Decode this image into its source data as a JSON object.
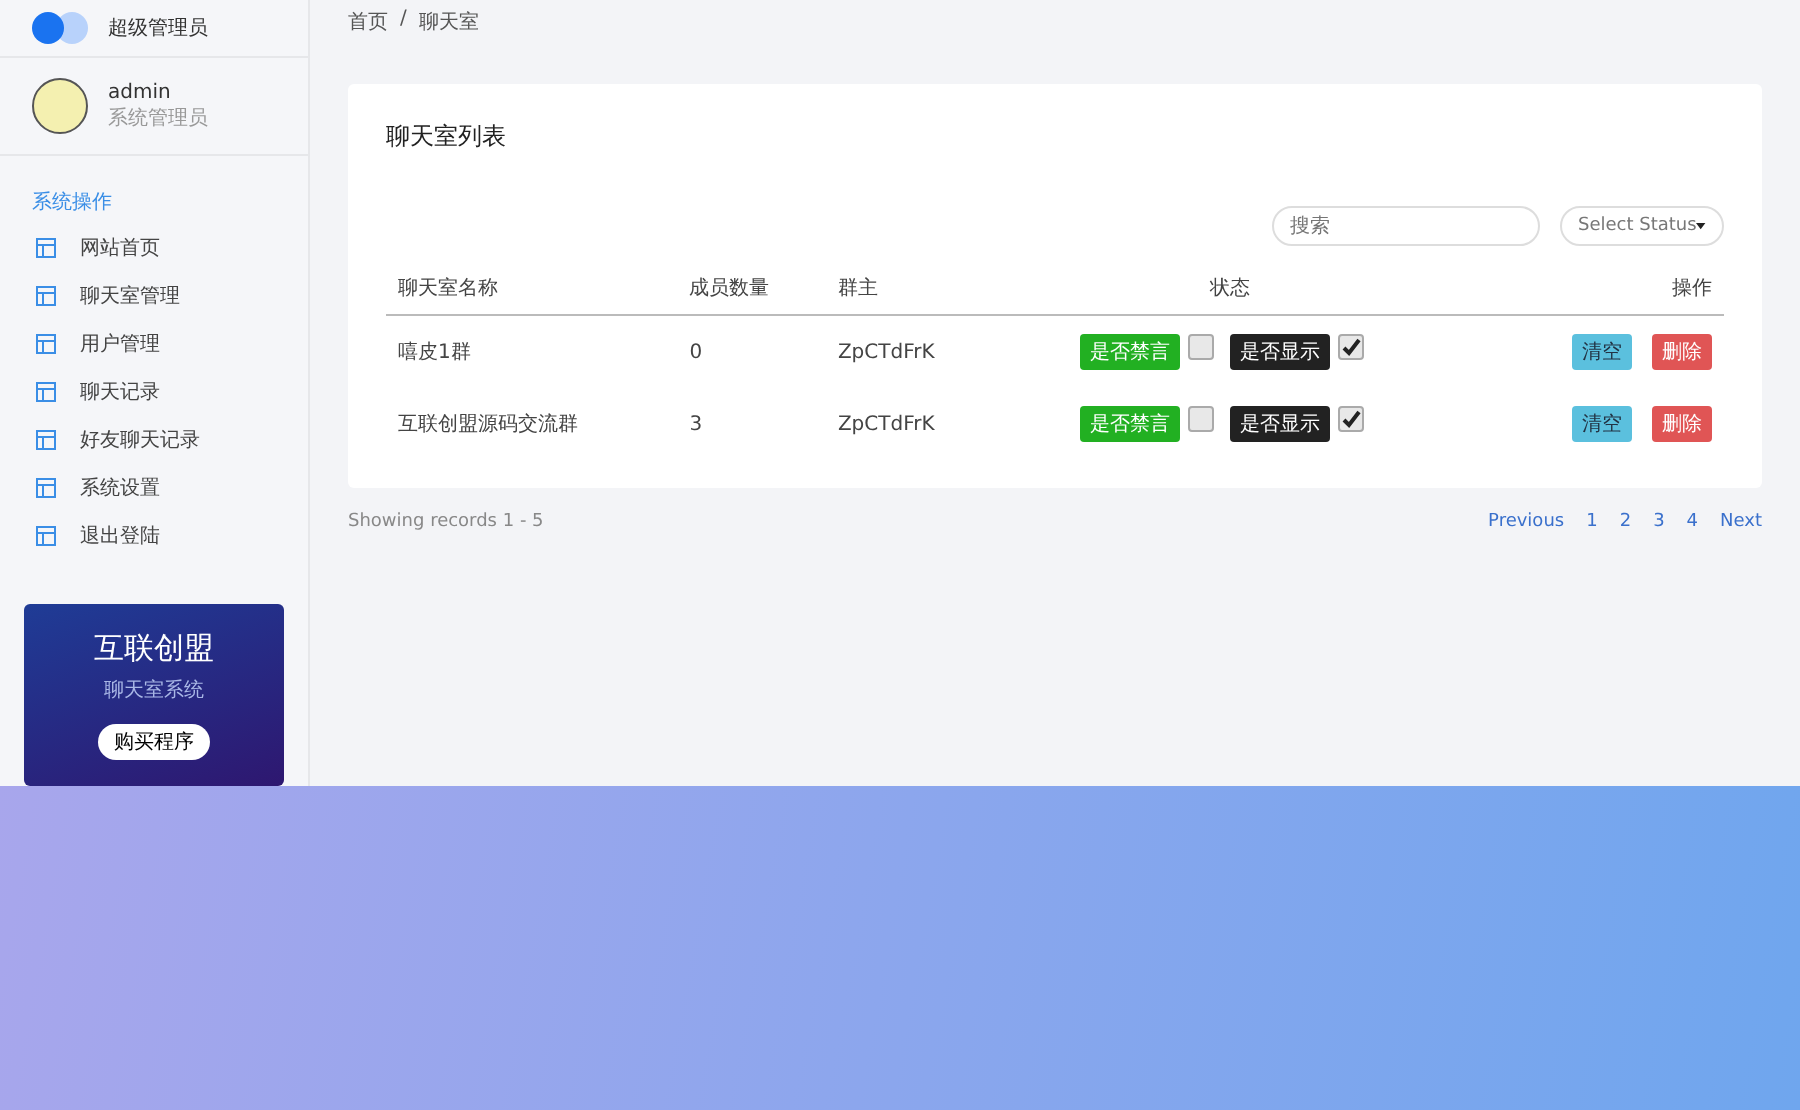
{
  "brand": {
    "title": "超级管理员"
  },
  "user": {
    "name": "admin",
    "role": "系统管理员"
  },
  "sidebar": {
    "section": "系统操作",
    "items": [
      {
        "label": "网站首页",
        "selected": false
      },
      {
        "label": "聊天室管理",
        "selected": false
      },
      {
        "label": "用户管理",
        "selected": false
      },
      {
        "label": "聊天记录",
        "selected": false
      },
      {
        "label": "好友聊天记录",
        "selected": false
      },
      {
        "label": "系统设置",
        "selected": false
      },
      {
        "label": "退出登陆",
        "selected": false
      }
    ]
  },
  "promo": {
    "title": "互联创盟",
    "subtitle": "聊天室系统",
    "button": "购买程序"
  },
  "breadcrumb": [
    "首页",
    "/",
    "聊天室"
  ],
  "card": {
    "title": "聊天室列表",
    "search": {
      "placeholder": "搜索"
    },
    "status_select": {
      "value": "Select Status"
    }
  },
  "table": {
    "columns": [
      "聊天室名称",
      "成员数量",
      "群主",
      "状态",
      "操作"
    ],
    "rows": [
      {
        "name": "嘻皮1群",
        "members": "0",
        "owner": "ZpCTdFrK",
        "mute_label": "是否禁言",
        "muted": false,
        "show_label": "是否显示",
        "shown": true,
        "clear": "清空",
        "delete": "删除"
      },
      {
        "name": "互联创盟源码交流群",
        "members": "3",
        "owner": "ZpCTdFrK",
        "mute_label": "是否禁言",
        "muted": false,
        "show_label": "是否显示",
        "shown": true,
        "clear": "清空",
        "delete": "删除"
      }
    ]
  },
  "footer": {
    "records": "Showing records 1 - 5",
    "pages": [
      {
        "label": "Previous"
      },
      {
        "label": "1"
      },
      {
        "label": "2"
      },
      {
        "label": "3"
      },
      {
        "label": "4"
      },
      {
        "label": "Next"
      }
    ]
  }
}
